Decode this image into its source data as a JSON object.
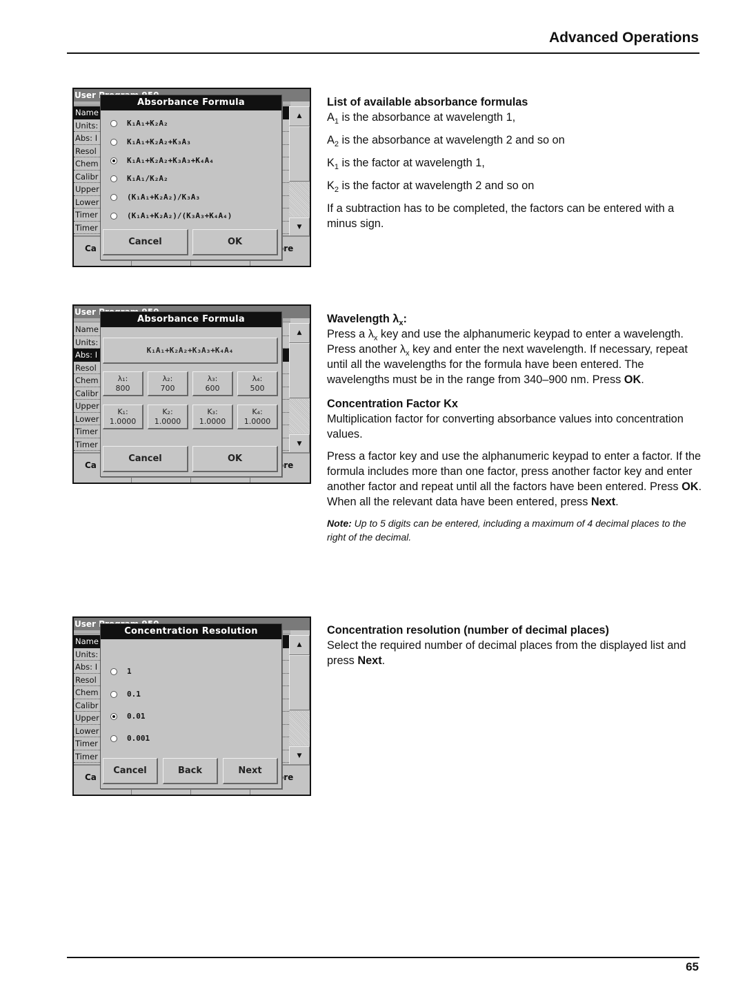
{
  "header": {
    "title": "Advanced Operations"
  },
  "footer": {
    "page_number": "65"
  },
  "screen_background": {
    "title": "User Program 950",
    "rows": [
      "Name",
      "Units:",
      "Abs: I",
      "Resol",
      "Chem",
      "Calibr",
      "Upper",
      "Lower",
      "Timer",
      "Timer"
    ],
    "bottom_buttons": [
      "Ca",
      "",
      "",
      "ore"
    ],
    "scroll_up_icon": "▲",
    "scroll_down_icon": "▼"
  },
  "screens": [
    {
      "dialog_title": "Absorbance Formula",
      "highlighted_row": 0,
      "options": [
        {
          "label": "K₁A₁+K₂A₂",
          "selected": false
        },
        {
          "label": "K₁A₁+K₂A₂+K₃A₃",
          "selected": false
        },
        {
          "label": "K₁A₁+K₂A₂+K₃A₃+K₄A₄",
          "selected": true
        },
        {
          "label": "K₁A₁/K₂A₂",
          "selected": false
        },
        {
          "label": "(K₁A₁+K₂A₂)/K₃A₃",
          "selected": false
        },
        {
          "label": "(K₁A₁+K₂A₂)/(K₃A₃+K₄A₄)",
          "selected": false
        }
      ],
      "buttons": [
        "Cancel",
        "OK"
      ]
    },
    {
      "dialog_title": "Absorbance Formula",
      "highlighted_row": 2,
      "formula": "K₁A₁+K₂A₂+K₃A₃+K₄A₄",
      "wavelength_keys": [
        {
          "label": "λ₁:",
          "value": "800"
        },
        {
          "label": "λ₂:",
          "value": "700"
        },
        {
          "label": "λ₃:",
          "value": "600"
        },
        {
          "label": "λ₄:",
          "value": "500"
        }
      ],
      "factor_keys": [
        {
          "label": "K₁:",
          "value": "1.0000"
        },
        {
          "label": "K₂:",
          "value": "1.0000"
        },
        {
          "label": "K₃:",
          "value": "1.0000"
        },
        {
          "label": "K₄:",
          "value": "1.0000"
        }
      ],
      "buttons": [
        "Cancel",
        "OK"
      ]
    },
    {
      "dialog_title": "Concentration Resolution",
      "highlighted_row": 0,
      "options": [
        {
          "label": "1",
          "selected": false
        },
        {
          "label": "0.1",
          "selected": false
        },
        {
          "label": "0.01",
          "selected": true
        },
        {
          "label": "0.001",
          "selected": false
        }
      ],
      "buttons": [
        "Cancel",
        "Back",
        "Next"
      ]
    }
  ],
  "sections": {
    "formulas": {
      "heading": "List of available absorbance formulas",
      "lines": [
        {
          "sym": "A",
          "sub": "1",
          "text": " is the absorbance at wavelength 1,"
        },
        {
          "sym": "A",
          "sub": "2",
          "text": " is the absorbance at wavelength 2 and so on"
        },
        {
          "sym": "K",
          "sub": "1",
          "text": " is the factor at wavelength 1,"
        },
        {
          "sym": "K",
          "sub": "2",
          "text": " is the factor at wavelength 2 and so on"
        }
      ],
      "subtraction": "If a subtraction has to be completed, the factors can be entered with a minus sign."
    },
    "wavelength": {
      "heading": "Wavelength λ",
      "heading_sub": "x",
      "heading_end": ":",
      "p1": "Press a λ",
      "p1_sub": "x",
      "p2": " key and use the alphanumeric keypad to enter a wavelength. Press another λ",
      "p2_sub": "x",
      "p3": " key and enter the next wavelength. If necessary, repeat until all the wavelengths for the formula have been entered. The wavelengths must be in the range from 340–900 nm. Press ",
      "p3_bold": "OK",
      "p3_end": "."
    },
    "factor": {
      "heading": "Concentration Factor Kx",
      "desc": "Multiplication factor for converting absorbance values into concentration values.",
      "para_a": "Press a factor key and use the alphanumeric keypad to enter a factor. If the formula includes more than one factor, press another factor key and enter another factor and repeat until all the factors have been entered. Press ",
      "para_b": "OK",
      "para_c": ". When all the relevant data have been entered, press ",
      "para_d": "Next",
      "para_e": ".",
      "note_label": "Note:",
      "note_text": " Up to 5 digits can be entered, including a maximum of 4 decimal places to the right of the decimal."
    },
    "resolution": {
      "heading": "Concentration resolution (number of decimal places)",
      "text_a": "Select the required number of decimal places from the displayed list and press ",
      "text_b": "Next",
      "text_c": "."
    }
  }
}
